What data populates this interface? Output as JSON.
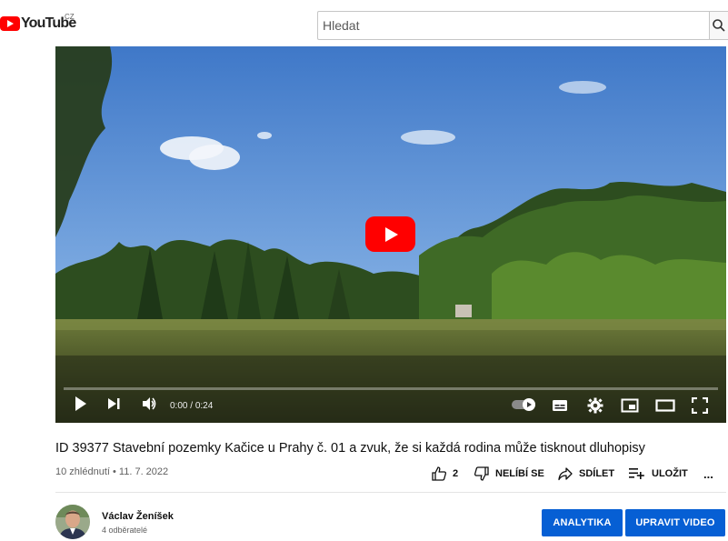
{
  "header": {
    "logo_text": "YouTube",
    "country_code": "CZ",
    "search_placeholder": "Hledat"
  },
  "player": {
    "time_current": "0:00",
    "time_separator": "/",
    "time_total": "0:24",
    "progress": 0,
    "icons": [
      "play-icon",
      "next-icon",
      "volume-icon",
      "autoplay-toggle",
      "subtitles-icon",
      "settings-gear-icon",
      "miniplayer-icon",
      "theater-mode-icon",
      "fullscreen-icon"
    ]
  },
  "video": {
    "title": "ID 39377 Stavební pozemky Kačice u Prahy č. 01 a zvuk, že si každá rodina může tisknout dluhopisy",
    "views": "10 zhlédnutí",
    "dot": "•",
    "date": "11. 7. 2022"
  },
  "actions": {
    "like_count": "2",
    "dislike_label": "NELÍBÍ SE",
    "share_label": "SDÍLET",
    "save_label": "ULOŽIT",
    "more_label": "..."
  },
  "channel": {
    "name": "Václav Ženíšek",
    "subscribers": "4 odběratelé"
  },
  "buttons": {
    "analytics_label": "ANALYTIKA",
    "edit_label": "UPRAVIT VIDEO"
  },
  "colors": {
    "brand_red": "#ff0000",
    "button_blue": "#065fd4"
  }
}
